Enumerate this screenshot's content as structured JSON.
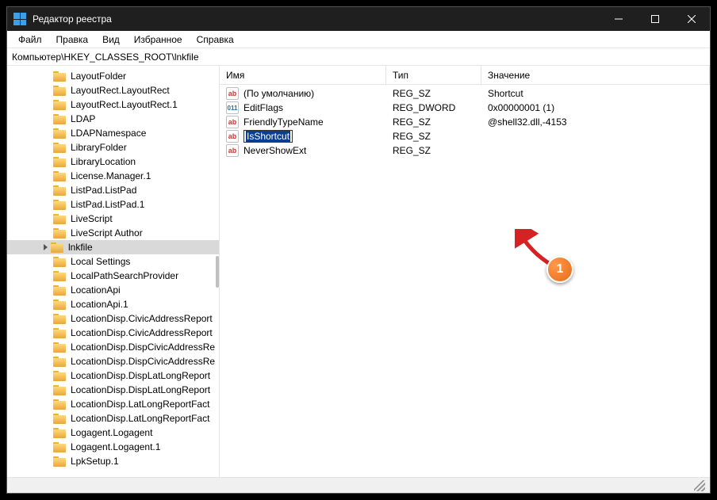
{
  "titlebar": {
    "title": "Редактор реестра"
  },
  "menu": {
    "items": [
      "Файл",
      "Правка",
      "Вид",
      "Избранное",
      "Справка"
    ]
  },
  "address": "Компьютер\\HKEY_CLASSES_ROOT\\lnkfile",
  "columns": {
    "name": "Имя",
    "type": "Тип",
    "value": "Значение"
  },
  "tree": [
    "LayoutFolder",
    "LayoutRect.LayoutRect",
    "LayoutRect.LayoutRect.1",
    "LDAP",
    "LDAPNamespace",
    "LibraryFolder",
    "LibraryLocation",
    "License.Manager.1",
    "ListPad.ListPad",
    "ListPad.ListPad.1",
    "LiveScript",
    "LiveScript Author",
    "lnkfile",
    "Local Settings",
    "LocalPathSearchProvider",
    "LocationApi",
    "LocationApi.1",
    "LocationDisp.CivicAddressReport",
    "LocationDisp.CivicAddressReport",
    "LocationDisp.DispCivicAddressRe",
    "LocationDisp.DispCivicAddressRe",
    "LocationDisp.DispLatLongReport",
    "LocationDisp.DispLatLongReport",
    "LocationDisp.LatLongReportFact",
    "LocationDisp.LatLongReportFact",
    "Logagent.Logagent",
    "Logagent.Logagent.1",
    "LpkSetup.1"
  ],
  "tree_selected": "lnkfile",
  "values": [
    {
      "name": "(По умолчанию)",
      "iconKind": "str",
      "iconLabel": "ab",
      "type": "REG_SZ",
      "data": "Shortcut",
      "editing": false
    },
    {
      "name": "EditFlags",
      "iconKind": "bin",
      "iconLabel": "011",
      "type": "REG_DWORD",
      "data": "0x00000001 (1)",
      "editing": false
    },
    {
      "name": "FriendlyTypeName",
      "iconKind": "str",
      "iconLabel": "ab",
      "type": "REG_SZ",
      "data": "@shell32.dll,-4153",
      "editing": false
    },
    {
      "name": "IsShortcut",
      "iconKind": "str",
      "iconLabel": "ab",
      "type": "REG_SZ",
      "data": "",
      "editing": true
    },
    {
      "name": "NeverShowExt",
      "iconKind": "str",
      "iconLabel": "ab",
      "type": "REG_SZ",
      "data": "",
      "editing": false
    }
  ],
  "annotation": {
    "badge": "1"
  }
}
